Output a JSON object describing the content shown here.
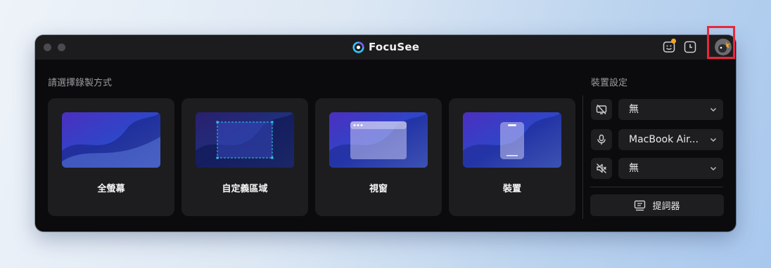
{
  "app": {
    "name": "FocuSee"
  },
  "titlebar": {
    "icons": [
      "feedback-icon",
      "history-icon",
      "avatar"
    ],
    "notification_color": "#f5a623"
  },
  "recording": {
    "heading": "請選擇錄製方式",
    "modes": [
      {
        "label": "全螢幕",
        "icon": "fullscreen-thumbnail"
      },
      {
        "label": "自定義區域",
        "icon": "custom-area-thumbnail"
      },
      {
        "label": "視窗",
        "icon": "window-thumbnail"
      },
      {
        "label": "裝置",
        "icon": "device-thumbnail"
      }
    ]
  },
  "device_settings": {
    "heading": "裝置設定",
    "camera": {
      "icon": "camera-off-icon",
      "value": "無"
    },
    "microphone": {
      "icon": "microphone-icon",
      "value": "MacBook Air..."
    },
    "system_audio": {
      "icon": "speaker-muted-icon",
      "value": "無"
    },
    "teleprompter": {
      "label": "提詞器",
      "icon": "teleprompter-icon"
    }
  },
  "colors": {
    "highlight": "#e8283c",
    "accent_cyan": "#33c7f2"
  }
}
